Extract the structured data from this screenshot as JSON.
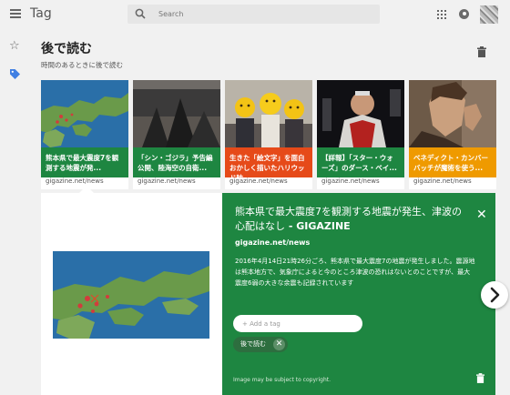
{
  "header": {
    "title": "Tag",
    "search_placeholder": "Search"
  },
  "page": {
    "title": "後で読む",
    "subtitle": "時間のあるときに後で読む"
  },
  "cards": [
    {
      "caption": "熊本県で最大震度7を観測する地震が発...",
      "domain": "gigazine.net/news",
      "color": "#1e8641"
    },
    {
      "caption": "「シン・ゴジラ」予告編公開、陸海空の自衛...",
      "domain": "gigazine.net/news",
      "color": "#1e8641"
    },
    {
      "caption": "生きた「絵文字」を面白おかしく描いたハリウッド映...",
      "domain": "gigazine.net/news",
      "color": "#e64a19"
    },
    {
      "caption": "【詳報】「スター・ウォーズ」のダース・ベイ...",
      "domain": "gigazine.net/news",
      "color": "#1e8641"
    },
    {
      "caption": "ベネディクト・カンバーバッチが魔術を使う...",
      "domain": "gigazine.net/news",
      "color": "#ef9a00"
    }
  ],
  "detail": {
    "title": "熊本県で最大震度7を観測する地震が発生、津波の心配はなし",
    "title_suffix": " - GIGAZINE",
    "domain": "gigazine.net/news",
    "description": "2016年4月14日21時26分ごろ、熊本県で最大震度7の地震が発生しました。震源地は熊本地方で、気象庁によると今のところ津波の恐れはないとのことですが、最大震度6弱の大きな余震も記録されています",
    "tag_placeholder": "+ Add a tag",
    "chip_label": "後で読む",
    "copyright": "Image may be subject to copyright."
  },
  "icons": {
    "menu": "menu-icon",
    "search": "search-icon",
    "apps": "apps-grid-icon",
    "account": "account-circle-icon",
    "star": "star-outline-icon",
    "tag": "tag-icon",
    "delete": "trash-icon",
    "close": "close-icon",
    "next": "chevron-right-icon"
  },
  "colors": {
    "accent_green": "#1e8641",
    "tag_blue": "#3f7fe3",
    "orange": "#ef9a00",
    "red_orange": "#e64a19"
  }
}
